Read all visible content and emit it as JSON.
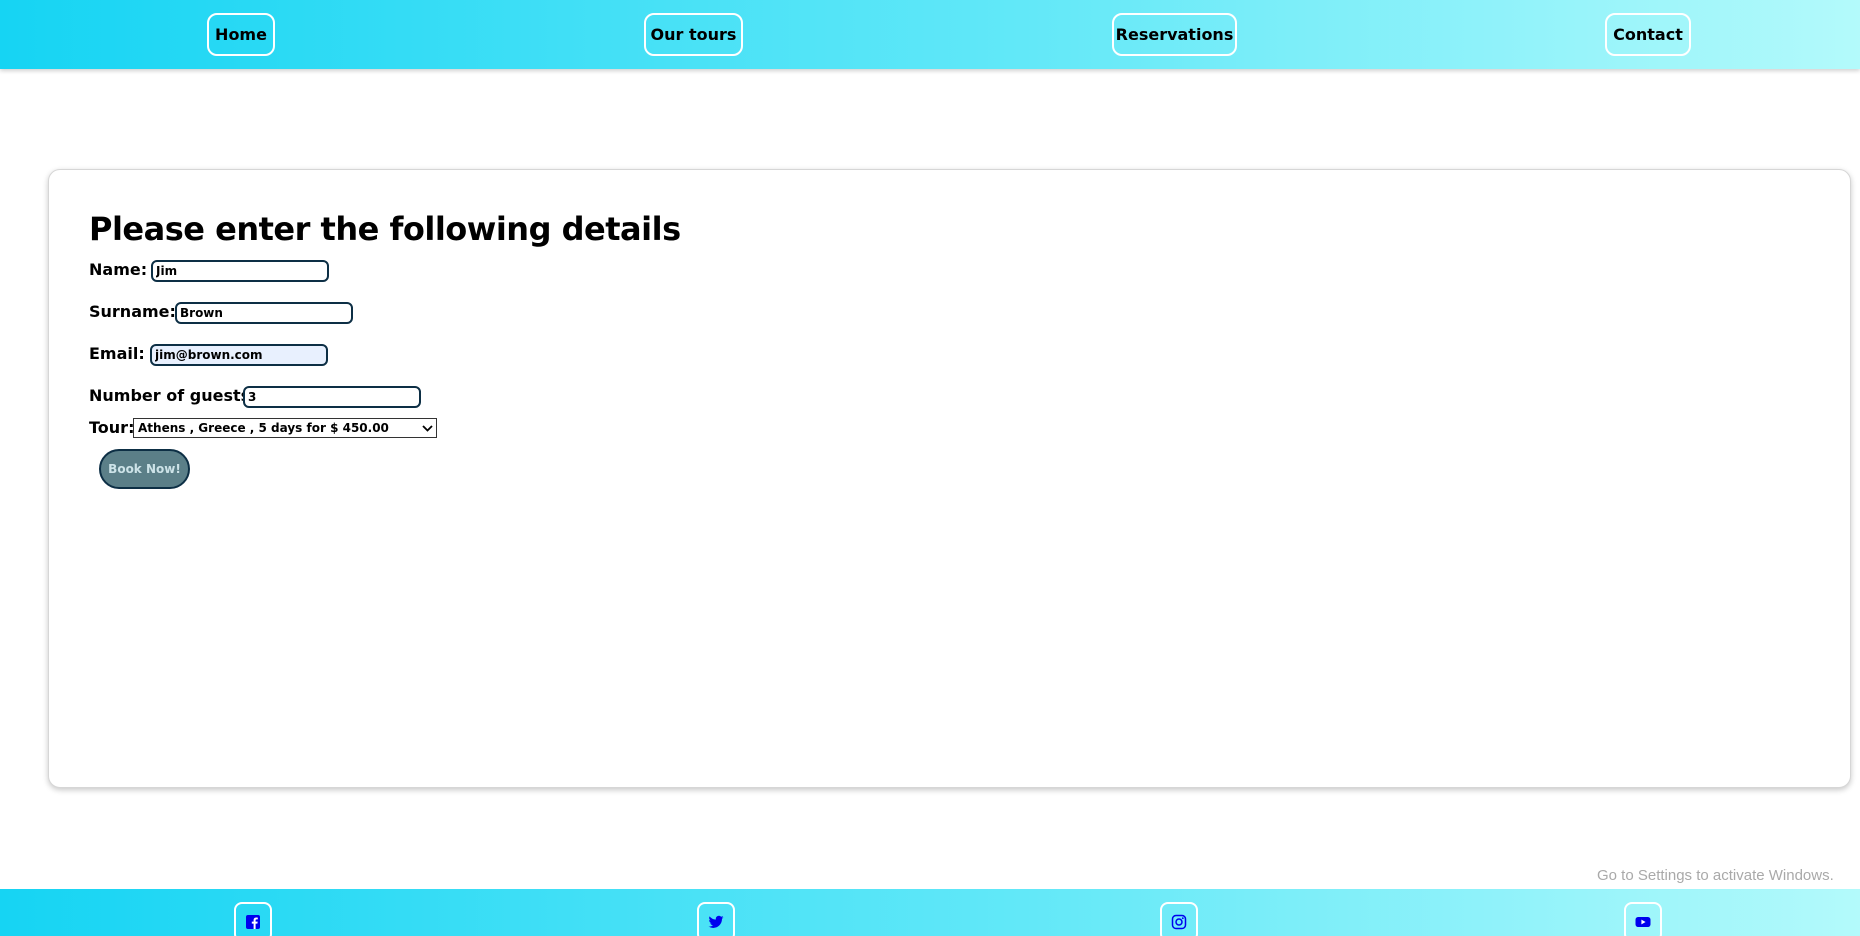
{
  "nav": {
    "items": [
      {
        "label": "Home"
      },
      {
        "label": "Our tours"
      },
      {
        "label": "Reservations"
      },
      {
        "label": "Contact"
      }
    ]
  },
  "form": {
    "heading": "Please enter the following details",
    "name": {
      "label": "Name:",
      "value": "Jim"
    },
    "surname": {
      "label": "Surname:",
      "value": "Brown"
    },
    "email": {
      "label": "Email:",
      "value": "jim@brown.com"
    },
    "guests": {
      "label": "Number of guests:",
      "value": "3"
    },
    "tour": {
      "label": "Tour:",
      "selected": "Athens , Greece , 5 days for $ 450.00"
    },
    "submit_label": "Book Now!"
  },
  "footer": {
    "icons": [
      "facebook-icon",
      "twitter-icon",
      "instagram-icon",
      "youtube-icon"
    ],
    "icon_color": "#0000ee"
  },
  "system": {
    "watermark": "Go to Settings to activate Windows."
  },
  "colors": {
    "nav_gradient_start": "#16d4f3",
    "nav_gradient_end": "#b3fafb",
    "button_bg": "#5b7f88",
    "field_border": "#0d2f45"
  }
}
